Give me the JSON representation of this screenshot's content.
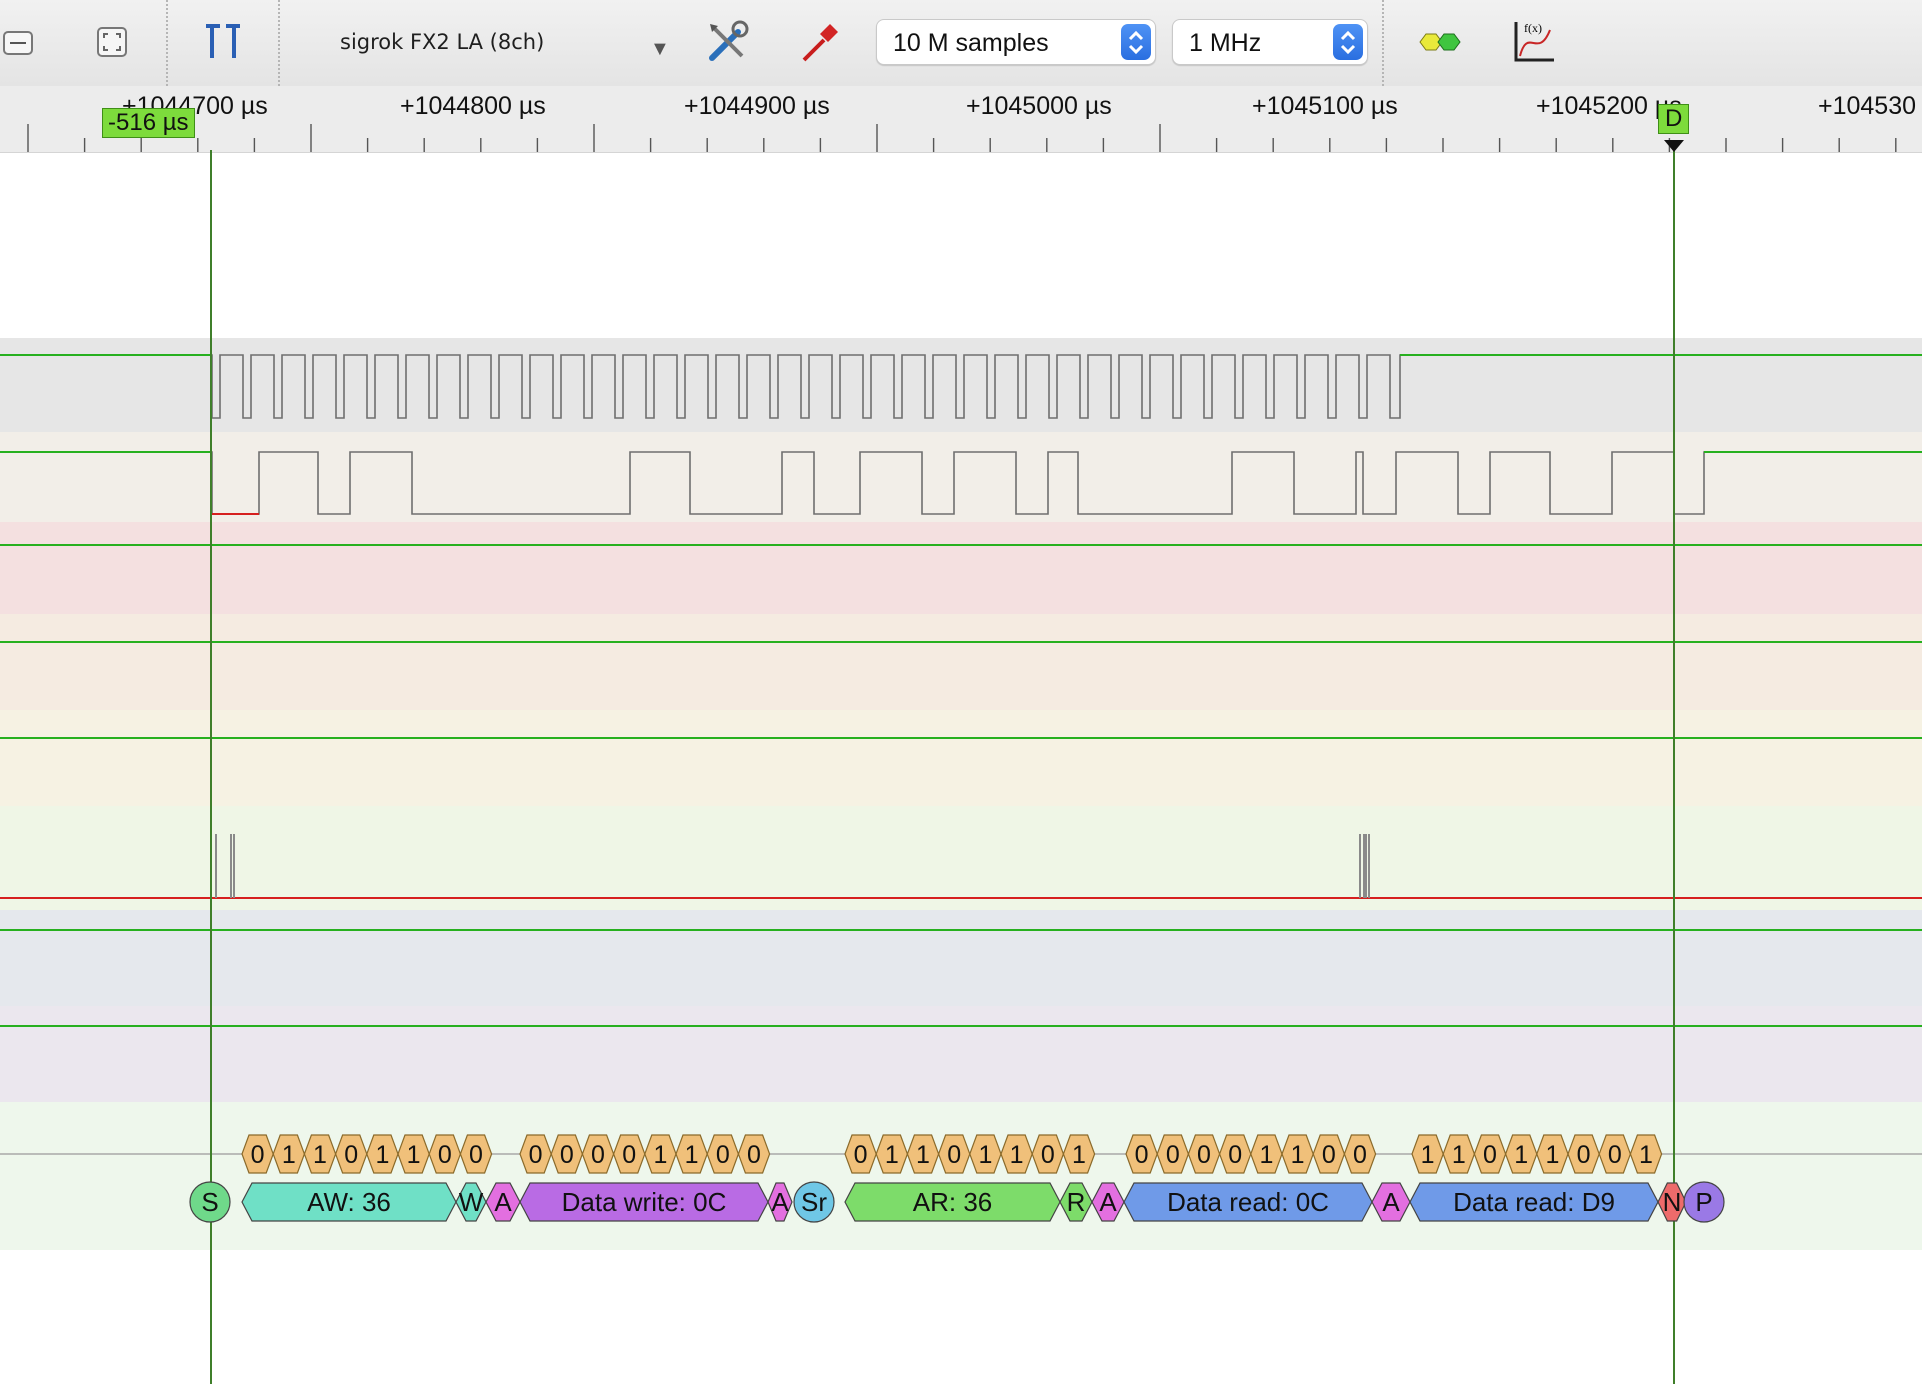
{
  "toolbar": {
    "device": "sigrok FX2 LA (8ch)",
    "samples": "10 M samples",
    "rate": "1 MHz"
  },
  "icons": [
    "minus-icon",
    "zoom-fit-icon",
    "cursors-icon",
    "dropdown-arrow-icon",
    "tools-icon",
    "probe-icon",
    "decoder-icon",
    "math-icon"
  ],
  "ruler": {
    "ticks": [
      "+1044700 µs",
      "+1044800 µs",
      "+1044900 µs",
      "+1045000 µs",
      "+1045100 µs",
      "+1045200 µs",
      "+104530"
    ],
    "cursor_label": "-516 µs",
    "marker_label": "D"
  },
  "decoder": {
    "bits": [
      [
        "0",
        "1",
        "1",
        "0",
        "1",
        "1",
        "0",
        "0"
      ],
      [
        "0",
        "0",
        "0",
        "0",
        "1",
        "1",
        "0",
        "0"
      ],
      [
        "0",
        "1",
        "1",
        "0",
        "1",
        "1",
        "0",
        "1"
      ],
      [
        "0",
        "0",
        "0",
        "0",
        "1",
        "1",
        "0",
        "0"
      ],
      [
        "1",
        "1",
        "0",
        "1",
        "1",
        "0",
        "0",
        "1"
      ]
    ],
    "annotations": [
      {
        "text": "S",
        "color": "#6fd98a",
        "kind": "circle"
      },
      {
        "text": "AW: 36",
        "color": "#6fe0c6",
        "kind": "hex"
      },
      {
        "text": "W",
        "color": "#6fe0c6",
        "kind": "hex"
      },
      {
        "text": "A",
        "color": "#e36fe0",
        "kind": "hex"
      },
      {
        "text": "Data write: 0C",
        "color": "#b96be4",
        "kind": "hex"
      },
      {
        "text": "A",
        "color": "#e36fe0",
        "kind": "hex"
      },
      {
        "text": "Sr",
        "color": "#6fc7e6",
        "kind": "circle"
      },
      {
        "text": "AR: 36",
        "color": "#7ddc6a",
        "kind": "hex"
      },
      {
        "text": "R",
        "color": "#7ddc6a",
        "kind": "hex"
      },
      {
        "text": "A",
        "color": "#e36fe0",
        "kind": "hex"
      },
      {
        "text": "Data read: 0C",
        "color": "#6f9ae8",
        "kind": "hex"
      },
      {
        "text": "A",
        "color": "#e36fe0",
        "kind": "hex"
      },
      {
        "text": "Data read: D9",
        "color": "#6f9ae8",
        "kind": "hex"
      },
      {
        "text": "N",
        "color": "#ee6b6b",
        "kind": "hex"
      },
      {
        "text": "P",
        "color": "#9a79e6",
        "kind": "circle"
      }
    ]
  },
  "colors": {
    "high": "#27b01f",
    "low": "#d61f1f",
    "bitfill": "#f0c07a"
  }
}
